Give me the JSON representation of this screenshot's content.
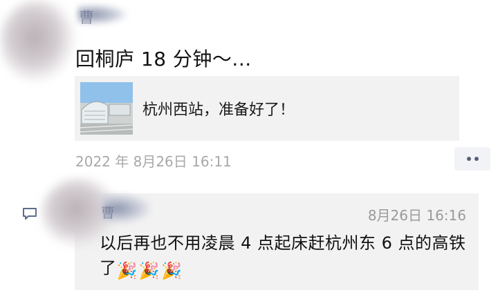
{
  "post": {
    "author_name": "曹",
    "text": "回桐庐 18 分钟～...",
    "link_title": "杭州西站，准备好了！",
    "link_icon": "train-station-thumbnail",
    "timestamp": "2022 年 8月26日 16:11",
    "more_icon": "more-dots-icon"
  },
  "comment": {
    "author_name": "曹",
    "time": "8月26日 16:16",
    "text": "以后再也不用凌晨 4 点起床赶杭州东 6 点的高铁了",
    "emojis": [
      "🎉",
      "🎉",
      "🎉"
    ],
    "icon": "comment-bubble-icon"
  }
}
